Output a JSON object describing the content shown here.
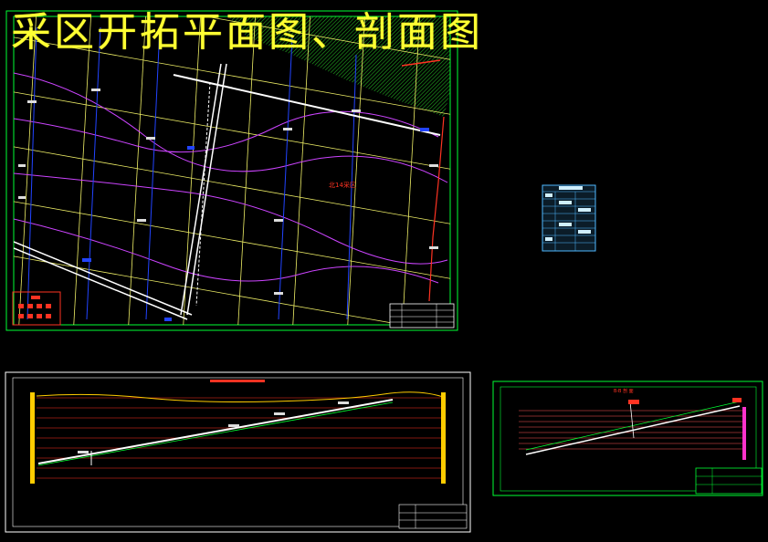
{
  "drawing": {
    "title": "采区开拓平面图、剖面图",
    "panel_label": "北14采区",
    "section_title_small": "B-B 剖 面"
  },
  "colors": {
    "background": "#000000",
    "title": "#ffff33",
    "frame_green": "#00ff33",
    "frame_white": "#ffffff",
    "grid_yellow": "#eeee66",
    "contour_magenta": "#cc44ff",
    "borehole_blue": "#2244ff",
    "fault_red": "#ff3322",
    "hatch_green": "#22aa22",
    "table_cyan": "#4fb8ff"
  },
  "icons": {
    "north_arrow": "north-arrow-icon",
    "legend": "legend-table-icon",
    "title_block": "title-block-icon"
  }
}
